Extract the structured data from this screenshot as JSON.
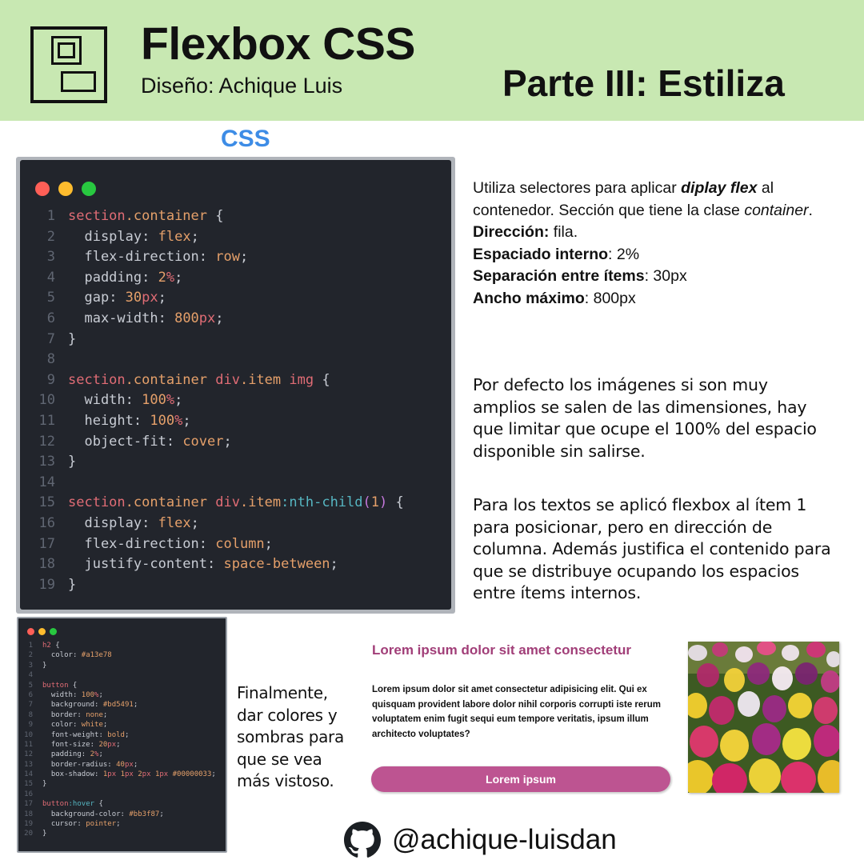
{
  "header": {
    "title": "Flexbox CSS",
    "subtitle": "Diseño: Achique Luis",
    "part": "Parte III: Estiliza",
    "background": "#c8e8b2",
    "logo_icon": "layout-logo-icon"
  },
  "section_label": "CSS",
  "code_main": {
    "lines": [
      {
        "n": "1",
        "segs": [
          {
            "t": "section",
            "c": "sel"
          },
          {
            "t": ".container",
            "c": "tag"
          },
          {
            "t": " {",
            "c": "pun"
          }
        ]
      },
      {
        "n": "2",
        "segs": [
          {
            "t": "  display",
            "c": "prop"
          },
          {
            "t": ": ",
            "c": "pun"
          },
          {
            "t": "flex",
            "c": "val"
          },
          {
            "t": ";",
            "c": "pun"
          }
        ]
      },
      {
        "n": "3",
        "segs": [
          {
            "t": "  flex-direction",
            "c": "prop"
          },
          {
            "t": ": ",
            "c": "pun"
          },
          {
            "t": "row",
            "c": "val"
          },
          {
            "t": ";",
            "c": "pun"
          }
        ]
      },
      {
        "n": "4",
        "segs": [
          {
            "t": "  padding",
            "c": "prop"
          },
          {
            "t": ": ",
            "c": "pun"
          },
          {
            "t": "2",
            "c": "num"
          },
          {
            "t": "%",
            "c": "unit"
          },
          {
            "t": ";",
            "c": "pun"
          }
        ]
      },
      {
        "n": "5",
        "segs": [
          {
            "t": "  gap",
            "c": "prop"
          },
          {
            "t": ": ",
            "c": "pun"
          },
          {
            "t": "30",
            "c": "num"
          },
          {
            "t": "px",
            "c": "unit"
          },
          {
            "t": ";",
            "c": "pun"
          }
        ]
      },
      {
        "n": "6",
        "segs": [
          {
            "t": "  max-width",
            "c": "prop"
          },
          {
            "t": ": ",
            "c": "pun"
          },
          {
            "t": "800",
            "c": "num"
          },
          {
            "t": "px",
            "c": "unit"
          },
          {
            "t": ";",
            "c": "pun"
          }
        ]
      },
      {
        "n": "7",
        "segs": [
          {
            "t": "}",
            "c": "pun"
          }
        ]
      },
      {
        "n": "8",
        "segs": []
      },
      {
        "n": "9",
        "segs": [
          {
            "t": "section",
            "c": "sel"
          },
          {
            "t": ".container",
            "c": "tag"
          },
          {
            "t": " div",
            "c": "sel"
          },
          {
            "t": ".item",
            "c": "tag"
          },
          {
            "t": " img",
            "c": "sel"
          },
          {
            "t": " {",
            "c": "pun"
          }
        ]
      },
      {
        "n": "10",
        "segs": [
          {
            "t": "  width",
            "c": "prop"
          },
          {
            "t": ": ",
            "c": "pun"
          },
          {
            "t": "100",
            "c": "num"
          },
          {
            "t": "%",
            "c": "unit"
          },
          {
            "t": ";",
            "c": "pun"
          }
        ]
      },
      {
        "n": "11",
        "segs": [
          {
            "t": "  height",
            "c": "prop"
          },
          {
            "t": ": ",
            "c": "pun"
          },
          {
            "t": "100",
            "c": "num"
          },
          {
            "t": "%",
            "c": "unit"
          },
          {
            "t": ";",
            "c": "pun"
          }
        ]
      },
      {
        "n": "12",
        "segs": [
          {
            "t": "  object-fit",
            "c": "prop"
          },
          {
            "t": ": ",
            "c": "pun"
          },
          {
            "t": "cover",
            "c": "val"
          },
          {
            "t": ";",
            "c": "pun"
          }
        ]
      },
      {
        "n": "13",
        "segs": [
          {
            "t": "}",
            "c": "pun"
          }
        ]
      },
      {
        "n": "14",
        "segs": []
      },
      {
        "n": "15",
        "segs": [
          {
            "t": "section",
            "c": "sel"
          },
          {
            "t": ".container",
            "c": "tag"
          },
          {
            "t": " div",
            "c": "sel"
          },
          {
            "t": ".item",
            "c": "tag"
          },
          {
            "t": ":nth-child",
            "c": "pseudo"
          },
          {
            "t": "(",
            "c": "purp"
          },
          {
            "t": "1",
            "c": "num"
          },
          {
            "t": ")",
            "c": "purp"
          },
          {
            "t": " {",
            "c": "pun"
          }
        ]
      },
      {
        "n": "16",
        "segs": [
          {
            "t": "  display",
            "c": "prop"
          },
          {
            "t": ": ",
            "c": "pun"
          },
          {
            "t": "flex",
            "c": "val"
          },
          {
            "t": ";",
            "c": "pun"
          }
        ]
      },
      {
        "n": "17",
        "segs": [
          {
            "t": "  flex-direction",
            "c": "prop"
          },
          {
            "t": ": ",
            "c": "pun"
          },
          {
            "t": "column",
            "c": "val"
          },
          {
            "t": ";",
            "c": "pun"
          }
        ]
      },
      {
        "n": "18",
        "segs": [
          {
            "t": "  justify-content",
            "c": "prop"
          },
          {
            "t": ": ",
            "c": "pun"
          },
          {
            "t": "space-between",
            "c": "val"
          },
          {
            "t": ";",
            "c": "pun"
          }
        ]
      },
      {
        "n": "19",
        "segs": [
          {
            "t": "}",
            "c": "pun"
          }
        ]
      }
    ]
  },
  "code_small": {
    "lines": [
      {
        "n": "1",
        "segs": [
          {
            "t": "h2",
            "c": "sel"
          },
          {
            "t": " {",
            "c": "pun"
          }
        ]
      },
      {
        "n": "2",
        "segs": [
          {
            "t": "  color",
            "c": "prop"
          },
          {
            "t": ": ",
            "c": "pun"
          },
          {
            "t": "#a13e78",
            "c": "val"
          }
        ]
      },
      {
        "n": "3",
        "segs": [
          {
            "t": "}",
            "c": "pun"
          }
        ]
      },
      {
        "n": "4",
        "segs": []
      },
      {
        "n": "5",
        "segs": [
          {
            "t": "button",
            "c": "sel"
          },
          {
            "t": " {",
            "c": "pun"
          }
        ]
      },
      {
        "n": "6",
        "segs": [
          {
            "t": "  width",
            "c": "prop"
          },
          {
            "t": ": ",
            "c": "pun"
          },
          {
            "t": "100",
            "c": "num"
          },
          {
            "t": "%",
            "c": "unit"
          },
          {
            "t": ";",
            "c": "pun"
          }
        ]
      },
      {
        "n": "7",
        "segs": [
          {
            "t": "  background",
            "c": "prop"
          },
          {
            "t": ": ",
            "c": "pun"
          },
          {
            "t": "#bd5491",
            "c": "val"
          },
          {
            "t": ";",
            "c": "pun"
          }
        ]
      },
      {
        "n": "8",
        "segs": [
          {
            "t": "  border",
            "c": "prop"
          },
          {
            "t": ": ",
            "c": "pun"
          },
          {
            "t": "none",
            "c": "val"
          },
          {
            "t": ";",
            "c": "pun"
          }
        ]
      },
      {
        "n": "9",
        "segs": [
          {
            "t": "  color",
            "c": "prop"
          },
          {
            "t": ": ",
            "c": "pun"
          },
          {
            "t": "white",
            "c": "val"
          },
          {
            "t": ";",
            "c": "pun"
          }
        ]
      },
      {
        "n": "10",
        "segs": [
          {
            "t": "  font-weight",
            "c": "prop"
          },
          {
            "t": ": ",
            "c": "pun"
          },
          {
            "t": "bold",
            "c": "val"
          },
          {
            "t": ";",
            "c": "pun"
          }
        ]
      },
      {
        "n": "11",
        "segs": [
          {
            "t": "  font-size",
            "c": "prop"
          },
          {
            "t": ": ",
            "c": "pun"
          },
          {
            "t": "20",
            "c": "num"
          },
          {
            "t": "px",
            "c": "unit"
          },
          {
            "t": ";",
            "c": "pun"
          }
        ]
      },
      {
        "n": "12",
        "segs": [
          {
            "t": "  padding",
            "c": "prop"
          },
          {
            "t": ": ",
            "c": "pun"
          },
          {
            "t": "2",
            "c": "num"
          },
          {
            "t": "%",
            "c": "unit"
          },
          {
            "t": ";",
            "c": "pun"
          }
        ]
      },
      {
        "n": "13",
        "segs": [
          {
            "t": "  border-radius",
            "c": "prop"
          },
          {
            "t": ": ",
            "c": "pun"
          },
          {
            "t": "40",
            "c": "num"
          },
          {
            "t": "px",
            "c": "unit"
          },
          {
            "t": ";",
            "c": "pun"
          }
        ]
      },
      {
        "n": "14",
        "segs": [
          {
            "t": "  box-shadow",
            "c": "prop"
          },
          {
            "t": ": ",
            "c": "pun"
          },
          {
            "t": "1",
            "c": "num"
          },
          {
            "t": "px ",
            "c": "unit"
          },
          {
            "t": "1",
            "c": "num"
          },
          {
            "t": "px ",
            "c": "unit"
          },
          {
            "t": "2",
            "c": "num"
          },
          {
            "t": "px ",
            "c": "unit"
          },
          {
            "t": "1",
            "c": "num"
          },
          {
            "t": "px ",
            "c": "unit"
          },
          {
            "t": "#00000033",
            "c": "val"
          },
          {
            "t": ";",
            "c": "pun"
          }
        ]
      },
      {
        "n": "15",
        "segs": [
          {
            "t": "}",
            "c": "pun"
          }
        ]
      },
      {
        "n": "16",
        "segs": []
      },
      {
        "n": "17",
        "segs": [
          {
            "t": "button",
            "c": "sel"
          },
          {
            "t": ":hover",
            "c": "pseudo"
          },
          {
            "t": " {",
            "c": "pun"
          }
        ]
      },
      {
        "n": "18",
        "segs": [
          {
            "t": "  background-color",
            "c": "prop"
          },
          {
            "t": ": ",
            "c": "pun"
          },
          {
            "t": "#bb3f87",
            "c": "val"
          },
          {
            "t": ";",
            "c": "pun"
          }
        ]
      },
      {
        "n": "19",
        "segs": [
          {
            "t": "  cursor",
            "c": "prop"
          },
          {
            "t": ": ",
            "c": "pun"
          },
          {
            "t": "pointer",
            "c": "val"
          },
          {
            "t": ";",
            "c": "pun"
          }
        ]
      },
      {
        "n": "20",
        "segs": [
          {
            "t": "}",
            "c": "pun"
          }
        ]
      }
    ]
  },
  "explanations": {
    "p1": {
      "pre": "Utiliza selectores para aplicar ",
      "em_bold": "diplay flex",
      "mid": " al contenedor. Sección que tiene la clase ",
      "em": "container",
      "end": ".",
      "dir_label": "Dirección:",
      "dir_value": " fila.",
      "pad_label": "Espaciado interno",
      "pad_value": ": 2%",
      "gap_label": "Separación entre ítems",
      "gap_value": ": 30px",
      "max_label": "Ancho máximo",
      "max_value": ": 800px"
    },
    "p2": "Por defecto los imágenes si son muy amplios se salen de las dimensiones, hay que limitar que ocupe el 100% del espacio disponible sin salirse.",
    "p3": "Para los textos se aplicó flexbox al ítem 1 para posicionar, pero en dirección de columna. Además justifica el contenido para que se  distribuye ocupando los espacios entre ítems internos.",
    "p4": "Finalmente, dar colores y sombras para que se vea más vistoso."
  },
  "demo": {
    "title": "Lorem ipsum dolor sit amet consectetur",
    "text": "Lorem ipsum dolor sit amet consectetur adipisicing elit. Qui ex quisquam provident labore dolor nihil corporis corrupti iste rerum voluptatem enim fugit sequi eum tempore veritatis, ipsum illum architecto voluptates?",
    "button_label": "Lorem ipsum",
    "title_color": "#a13e78",
    "button_color": "#bd5491"
  },
  "footer": {
    "icon": "github-icon",
    "handle": "@achique-luisdan"
  }
}
